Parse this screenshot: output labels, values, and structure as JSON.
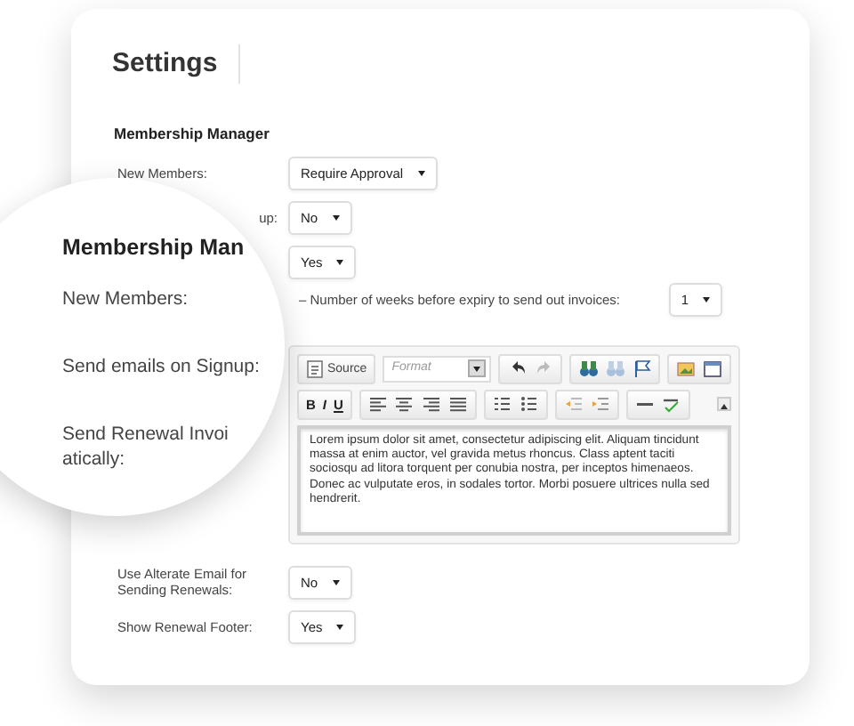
{
  "page": {
    "title": "Settings"
  },
  "section": {
    "title": "Membership Manager"
  },
  "rows": [
    {
      "kind": "select",
      "label": "New Members:",
      "value": "Require Approval"
    },
    {
      "kind": "select",
      "label": "up:",
      "value": "No"
    },
    {
      "kind": "select",
      "value": "Yes"
    },
    {
      "kind": "indented",
      "label": "– Number of weeks before expiry to send out invoices:",
      "value": "1"
    },
    {
      "kind": "editor",
      "toolbar": {
        "source": "Source",
        "format_placeholder": "Format",
        "bold": "B",
        "italic": "I",
        "underline": "U",
        "redo_disabled": true
      },
      "text": "Lorem ipsum dolor sit amet, consectetur adipiscing elit. Aliquam tincidunt massa at enim auctor, vel gravida metus rhoncus. Class aptent taciti sociosqu ad litora torquent per conubia nostra, per inceptos himenaeos. Donec ac vulputate eros, in sodales tortor. Morbi posuere ultrices nulla sed hendrerit."
    },
    {
      "kind": "select",
      "label": "Use Alterate Email for Sending Renewals:",
      "value": "No"
    },
    {
      "kind": "select",
      "label": "Show Renewal Footer:",
      "value": "Yes"
    }
  ],
  "magnifier": {
    "heading": "Membership Man",
    "labels": [
      {
        "lines": [
          "New Members:"
        ]
      },
      {
        "lines": [
          "Send emails on Signup:"
        ]
      },
      {
        "lines": [
          "Send Renewal Invoi",
          "atically:"
        ]
      }
    ]
  }
}
